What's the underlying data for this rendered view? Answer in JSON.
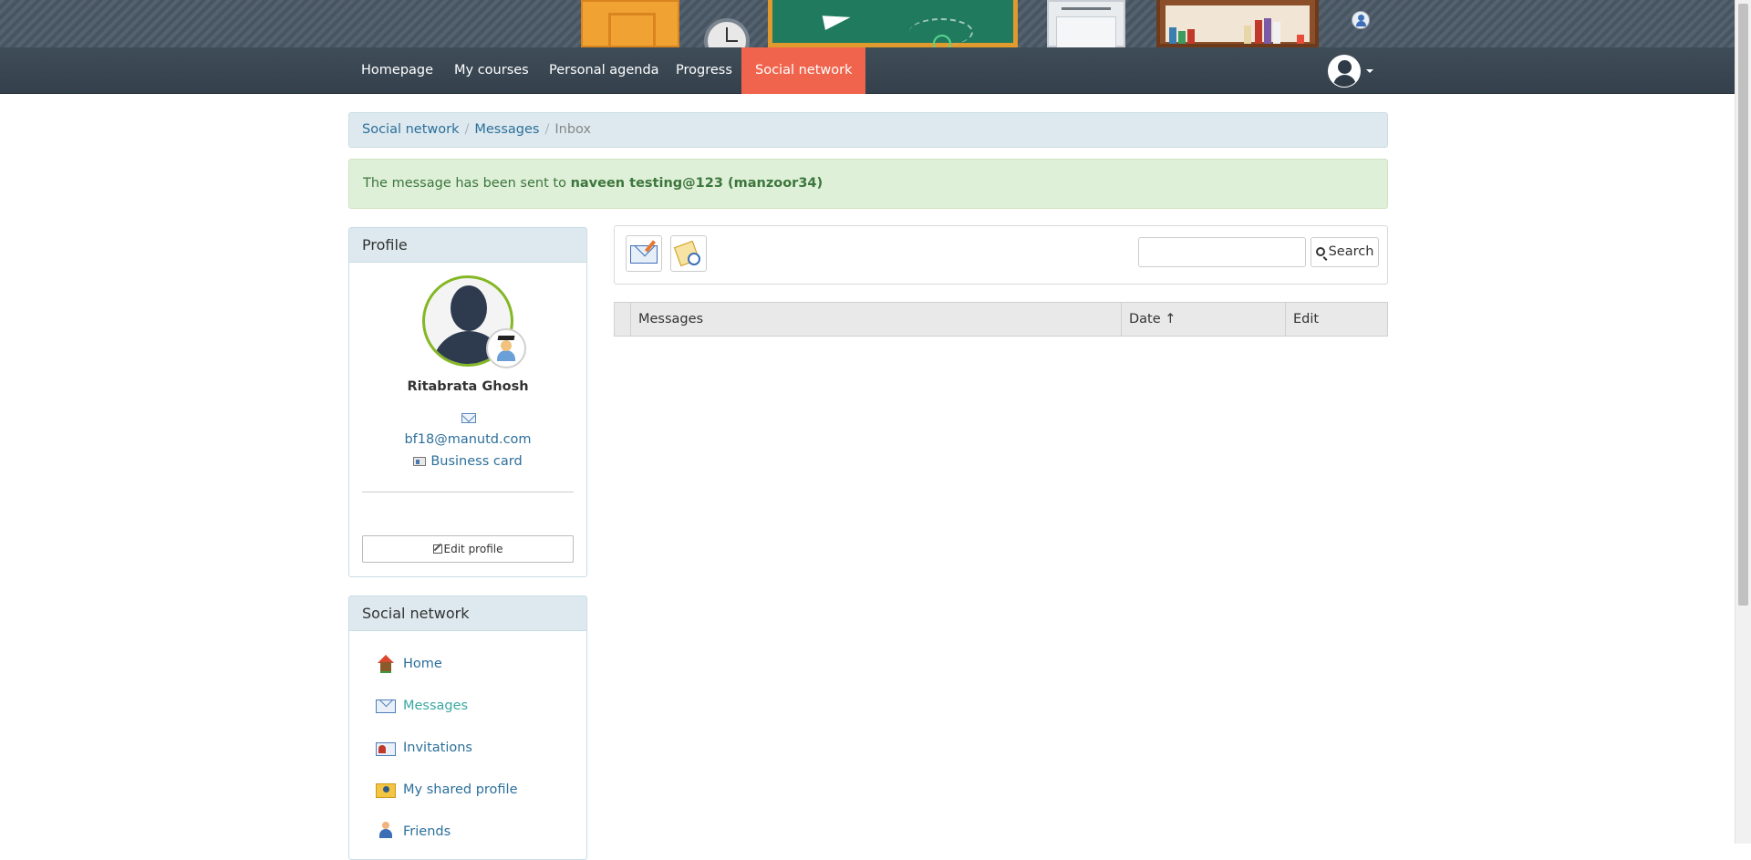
{
  "nav": {
    "items": [
      {
        "label": "Homepage"
      },
      {
        "label": "My courses"
      },
      {
        "label": "Personal agenda"
      },
      {
        "label": "Progress"
      },
      {
        "label": "Social network"
      }
    ],
    "active_index": 4,
    "accent_color": "#f0644d"
  },
  "breadcrumb": {
    "items": [
      "Social network",
      "Messages"
    ],
    "current": "Inbox"
  },
  "alert": {
    "prefix": "The message has been sent to ",
    "recipient": "naveen testing@123 (manzoor34)"
  },
  "profile": {
    "title": "Profile",
    "name": "Ritabrata Ghosh",
    "email": "bf18@manutd.com",
    "business_card": "Business card",
    "edit_label": "Edit profile",
    "avatar_ring_color": "#84b724"
  },
  "social": {
    "title": "Social network",
    "items": [
      {
        "label": "Home",
        "icon": "home-icon"
      },
      {
        "label": "Messages",
        "icon": "messages-icon"
      },
      {
        "label": "Invitations",
        "icon": "invitations-icon"
      },
      {
        "label": "My shared profile",
        "icon": "shared-profile-icon"
      },
      {
        "label": "Friends",
        "icon": "friends-icon"
      }
    ],
    "active_item": "Messages"
  },
  "toolbar": {
    "search_placeholder": "",
    "search_value": "",
    "search_label": "Search"
  },
  "grid": {
    "columns": [
      "Messages",
      "Date ↑",
      "Edit"
    ]
  }
}
